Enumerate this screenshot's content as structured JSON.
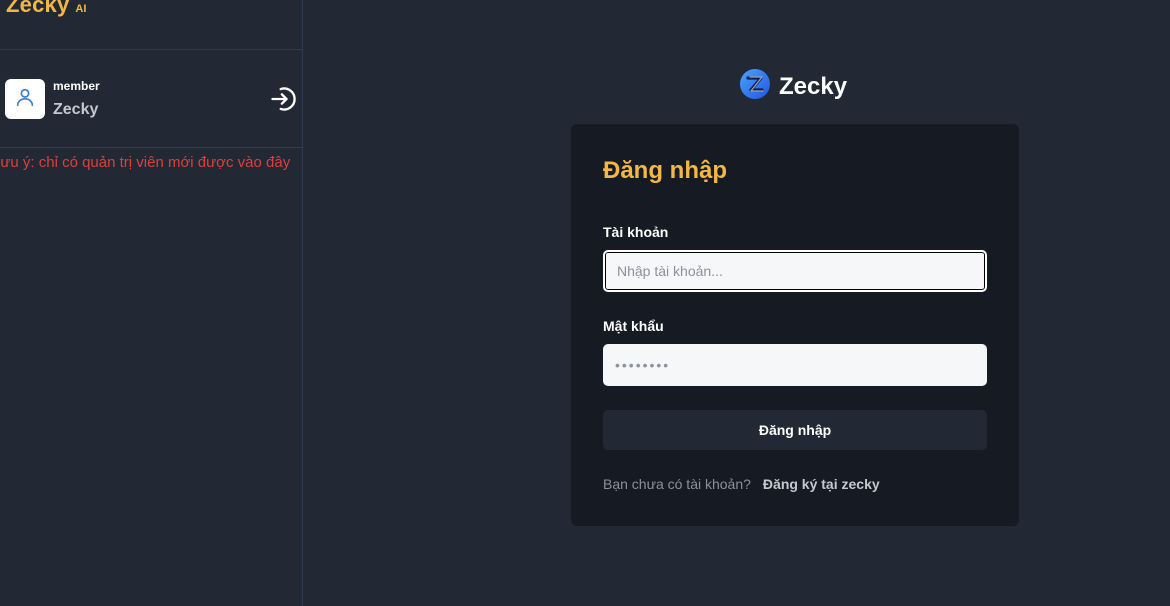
{
  "sidebar": {
    "brand": "Zecky",
    "brand_suffix": "AI",
    "user": {
      "role": "member",
      "name": "Zecky"
    },
    "notice": "Lưu ý: chỉ có quản trị viên mới được vào đây"
  },
  "main": {
    "logo_text": "Zecky",
    "login": {
      "title": "Đăng nhập",
      "account_label": "Tài khoản",
      "account_placeholder": "Nhập tài khoản...",
      "password_label": "Mật khẩu",
      "password_placeholder": "••••••••",
      "submit_label": "Đăng nhập",
      "signup_prompt": "Bạn chưa có tài khoản?",
      "signup_link": "Đăng ký tại zecky"
    }
  },
  "colors": {
    "background": "#222834",
    "card": "#151a23",
    "accent": "#f3b843",
    "notice": "#d9413d",
    "logo_blue": "#2f7cf6"
  },
  "icons": {
    "avatar": "user-icon",
    "logout": "sign-in-icon",
    "logo": "zecky-logo-icon"
  }
}
